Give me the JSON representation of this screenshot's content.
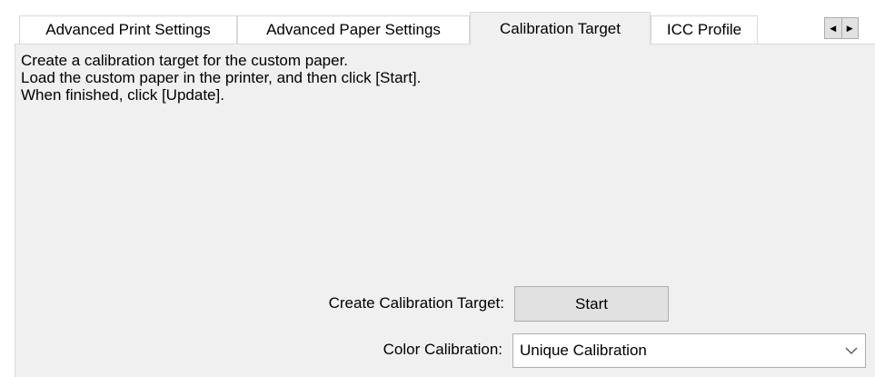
{
  "tabs": [
    {
      "label": "Advanced Print Settings",
      "active": false
    },
    {
      "label": "Advanced Paper Settings",
      "active": false
    },
    {
      "label": "Calibration Target",
      "active": true
    },
    {
      "label": "ICC Profile",
      "active": false
    }
  ],
  "scroll": {
    "left_icon": "scroll-left-icon",
    "right_icon": "scroll-right-icon"
  },
  "description": {
    "line1": "Create a calibration target for the custom paper.",
    "line2": "Load the custom paper in the printer, and then click [Start].",
    "line3": "When finished, click [Update]."
  },
  "create_target": {
    "label": "Create Calibration Target:",
    "button_label": "Start"
  },
  "color_calibration": {
    "label": "Color Calibration:",
    "selected": "Unique Calibration",
    "icon": "chevron-down-icon"
  },
  "colors": {
    "panel_bg": "#f0f0f0",
    "border": "#d9d9d9",
    "button_bg": "#e1e1e1"
  }
}
